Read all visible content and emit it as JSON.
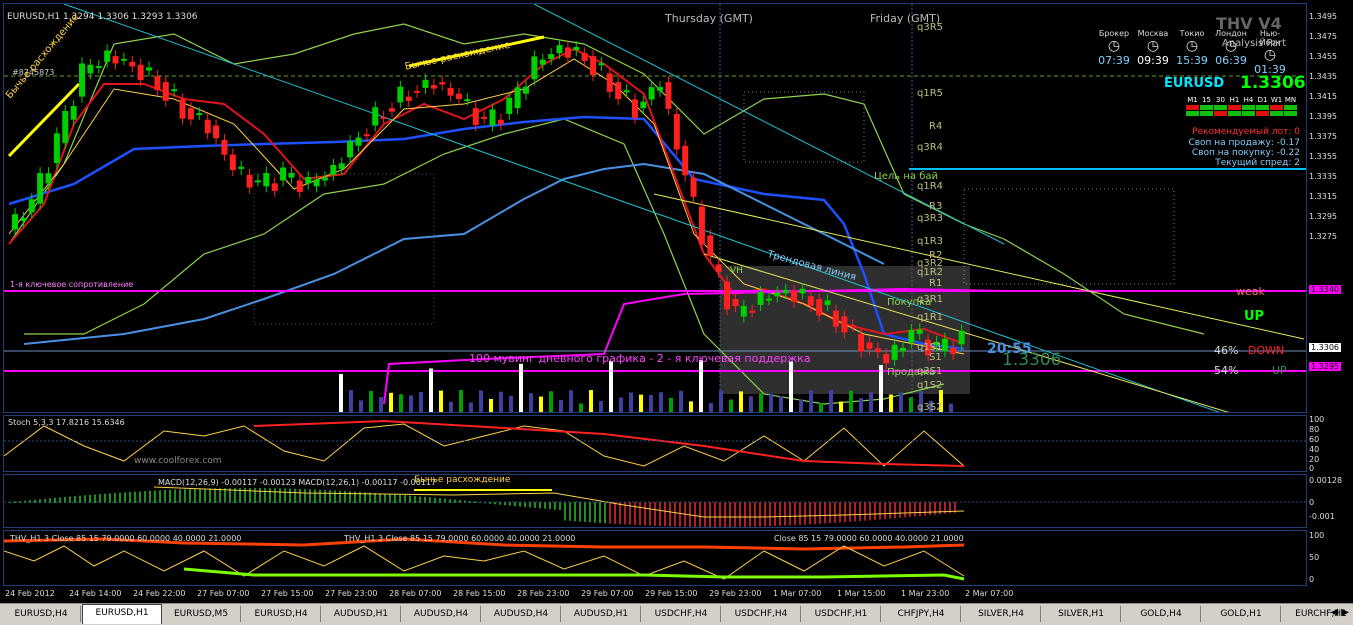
{
  "header": {
    "symbol_info": "EURUSD,H1  1.3294 1.3306 1.3293 1.3306",
    "thursday": "Thursday   (GMT)",
    "friday": "Friday   (GMT)",
    "thv": "THV V4",
    "order_id": "#8745873",
    "www": "www.coolforex.com"
  },
  "clocks": {
    "labels": [
      "Брокер",
      "Москва",
      "Токио",
      "Лондон",
      "Нью-Йорк"
    ],
    "times": [
      "07:39",
      "09:39",
      "15:39",
      "06:39",
      "01:39"
    ],
    "analysis": "Analysis Part"
  },
  "info_panel": {
    "symbol": "EURUSD",
    "price": "1.3306",
    "timeframes": [
      "M1",
      "15",
      "30",
      "H1",
      "H4",
      "D1",
      "W1",
      "MN"
    ],
    "lot": "Рекомендуемый лот: 0",
    "swap_sell": "Своп на продажу: -0.17",
    "swap_buy": "Своп на покупку: -0.22",
    "spread": "Текущий спред: 2"
  },
  "annotations": {
    "bull_div_left": "Бычье расхождение",
    "bull_div_top": "Бычье расхождение",
    "bull_div_macd": "Бычье расхождение",
    "resistance": "1-я ключевое сопротивление",
    "support": "100 мувинг дневного графика - 2 - я ключевая поддержка",
    "trend": "Трендовая линия",
    "target_buy": "Цель на бай",
    "buy": "Покупка",
    "sell": "Продажа",
    "vh": "VH",
    "timer": "20:55",
    "big_price": "1.3306",
    "weak": "weak",
    "up": "UP",
    "pct_down": "46%",
    "down": "DOWN",
    "pct_up": "54%",
    "up2": "UP"
  },
  "pivot_labels": [
    "q3R5",
    "q1R5",
    "R4",
    "q3R4",
    "q1R4",
    "R3",
    "q3R3",
    "q1R3",
    "R2",
    "q3R2",
    "q1R2",
    "R1",
    "q3R1",
    "q1R1",
    "q1S1",
    "S1",
    "q3S1",
    "q1S2",
    "q3S2"
  ],
  "right_axis_main": [
    "1.3495",
    "1.3475",
    "1.3455",
    "1.3435",
    "1.3415",
    "1.3395",
    "1.3375",
    "1.3355",
    "1.3335",
    "1.3315",
    "1.3295",
    "1.3275"
  ],
  "price_tags": [
    {
      "value": "1.3340",
      "color": "#ff00ff"
    },
    {
      "value": "1.3306",
      "color": "#ffffff"
    },
    {
      "value": "1.3295",
      "color": "#ff00ff"
    }
  ],
  "stoch": {
    "label": "Stoch 5,3,3  17.8216 15.6346",
    "levels": [
      "100",
      "80",
      "60",
      "40",
      "20",
      "0"
    ]
  },
  "macd": {
    "label": "MACD(12,26,9) -0.00117 -0.00123  MACD(12,26,1) -0.00117 -0.00117",
    "levels": [
      "0.00128",
      "0",
      "-0.001"
    ]
  },
  "thv": {
    "label_left": "THV_H1   3   Close   85   15 79.0000 60.0000 40.0000 21.0000",
    "label_mid": "THV_H1   3   Close   85   15 79.0000 60.0000 40.0000 21.0000",
    "label_right": "Close   85   15 79.0000 60.0000 40.0000 21.0000",
    "levels": [
      "100",
      "50",
      "0"
    ]
  },
  "chart_data": {
    "type": "candlestick",
    "symbol": "EURUSD",
    "timeframe": "H1",
    "x_ticks": [
      "24 Feb 2012",
      "24 Feb 14:00",
      "24 Feb 22:00",
      "27 Feb 07:00",
      "27 Feb 15:00",
      "27 Feb 23:00",
      "28 Feb 07:00",
      "28 Feb 15:00",
      "28 Feb 23:00",
      "29 Feb 07:00",
      "29 Feb 15:00",
      "29 Feb 23:00",
      "1 Mar 07:00",
      "1 Mar 15:00",
      "1 Mar 23:00",
      "2 Mar 07:00"
    ],
    "ylim": [
      1.3265,
      1.35
    ],
    "close_path": [
      1.337,
      1.3385,
      1.342,
      1.346,
      1.347,
      1.3465,
      1.3455,
      1.344,
      1.343,
      1.3405,
      1.3395,
      1.34,
      1.3395,
      1.3405,
      1.3425,
      1.344,
      1.345,
      1.3455,
      1.3445,
      1.343,
      1.344,
      1.3465,
      1.3475,
      1.347,
      1.3455,
      1.344,
      1.3455,
      1.34,
      1.335,
      1.332,
      1.333,
      1.3335,
      1.333,
      1.332,
      1.3305,
      1.3295,
      1.331,
      1.33,
      1.3306
    ],
    "horizontal_levels": [
      {
        "name": "resistance",
        "value": 1.334,
        "color": "#ff00ff"
      },
      {
        "name": "support",
        "value": 1.3295,
        "color": "#ff00ff"
      },
      {
        "name": "current",
        "value": 1.3306,
        "color": "#ffffff"
      },
      {
        "name": "target",
        "value": 1.341,
        "color": "#00bfff"
      }
    ],
    "grid": false
  }
}
